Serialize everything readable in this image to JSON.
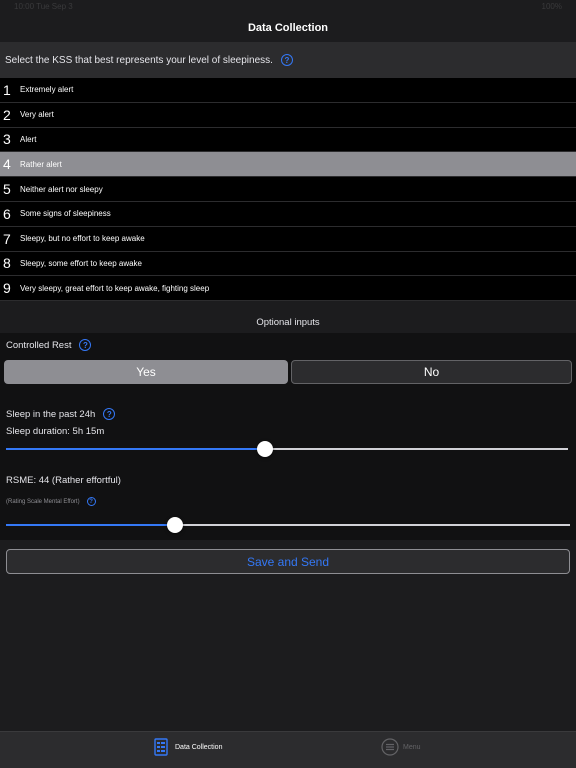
{
  "status": {
    "left": "10:00 Tue Sep 3",
    "right": "100%"
  },
  "nav": {
    "title": "Data Collection"
  },
  "prompt": {
    "text": "Select the KSS that best represents your level of sleepiness."
  },
  "kss": {
    "selected_index": 3,
    "items": [
      {
        "num": "1",
        "label": "Extremely alert"
      },
      {
        "num": "2",
        "label": "Very alert"
      },
      {
        "num": "3",
        "label": "Alert"
      },
      {
        "num": "4",
        "label": "Rather alert"
      },
      {
        "num": "5",
        "label": "Neither alert nor sleepy"
      },
      {
        "num": "6",
        "label": "Some signs of sleepiness"
      },
      {
        "num": "7",
        "label": "Sleepy, but no effort to keep awake"
      },
      {
        "num": "8",
        "label": "Sleepy, some effort to keep awake"
      },
      {
        "num": "9",
        "label": "Very sleepy, great effort to keep awake, fighting sleep"
      }
    ]
  },
  "optional": {
    "header": "Optional inputs",
    "controlled_rest": {
      "label": "Controlled Rest",
      "yes": "Yes",
      "no": "No",
      "selected": "Yes"
    },
    "sleep": {
      "label": "Sleep in the past 24h",
      "duration_label": "Sleep duration: 5h 15m",
      "fraction": 0.46
    },
    "rsme": {
      "label": "RSME: 44    (Rather effortful)",
      "sub_label": "(Rating Scale Mental Effort)",
      "fraction": 0.3
    }
  },
  "save": {
    "label": "Save and Send"
  },
  "tabs": [
    {
      "label": "Data Collection",
      "active": true
    },
    {
      "label": "Menu",
      "active": false
    }
  ],
  "colors": {
    "accent": "#3478f6",
    "selected_row": "#8e8e93",
    "background": "#1c1c1e"
  },
  "icons": {
    "help": "?"
  }
}
